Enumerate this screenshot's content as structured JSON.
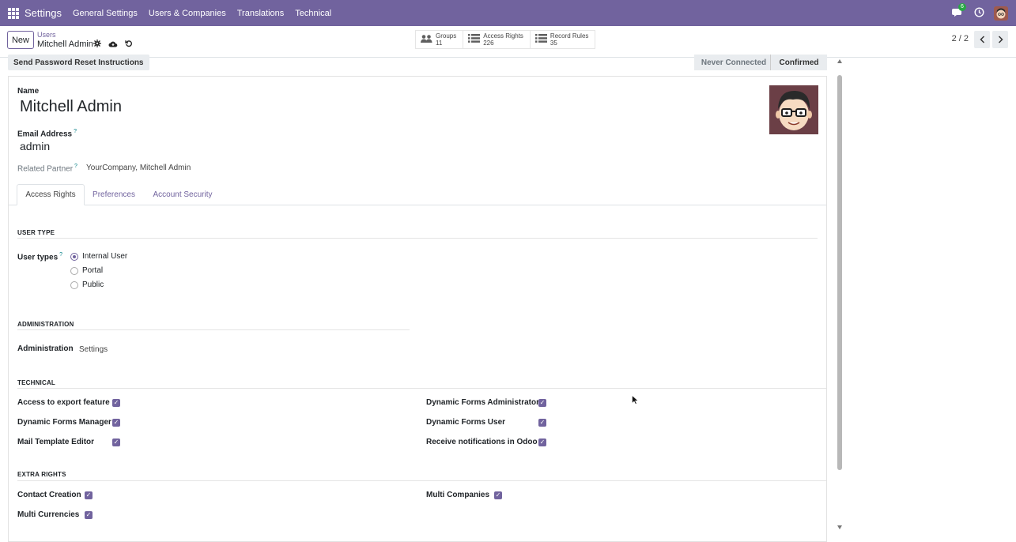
{
  "navbar": {
    "brand": "Settings",
    "menus": [
      "General Settings",
      "Users & Companies",
      "Translations",
      "Technical"
    ],
    "chat_badge": "6"
  },
  "control": {
    "new_label": "New",
    "breadcrumb_parent": "Users",
    "breadcrumb_current": "Mitchell Admin",
    "stats": [
      {
        "label": "Groups",
        "value": "11"
      },
      {
        "label": "Access Rights",
        "value": "226"
      },
      {
        "label": "Record Rules",
        "value": "35"
      }
    ],
    "pager": "2 / 2"
  },
  "statusbar": {
    "reset_label": "Send Password Reset Instructions",
    "stage_never": "Never Connected",
    "stage_confirmed": "Confirmed"
  },
  "form": {
    "name_label": "Name",
    "name_value": "Mitchell Admin",
    "email_label": "Email Address",
    "email_value": "admin",
    "partner_label": "Related Partner",
    "partner_value": "YourCompany, Mitchell Admin",
    "help_mark": "?",
    "tabs": [
      "Access Rights",
      "Preferences",
      "Account Security"
    ],
    "user_type_section": "USER TYPE",
    "user_types_label": "User types",
    "user_types": [
      "Internal User",
      "Portal",
      "Public"
    ],
    "administration_section": "ADMINISTRATION",
    "administration_label": "Administration",
    "administration_value": "Settings",
    "technical_section": "TECHNICAL",
    "technical_left": [
      "Access to export feature",
      "Dynamic Forms Manager",
      "Mail Template Editor"
    ],
    "technical_right": [
      "Dynamic Forms Administrator",
      "Dynamic Forms User",
      "Receive notifications in Odoo"
    ],
    "extra_section": "EXTRA RIGHTS",
    "extra_left": [
      "Contact Creation",
      "Multi Currencies"
    ],
    "extra_right": [
      "Multi Companies"
    ]
  }
}
